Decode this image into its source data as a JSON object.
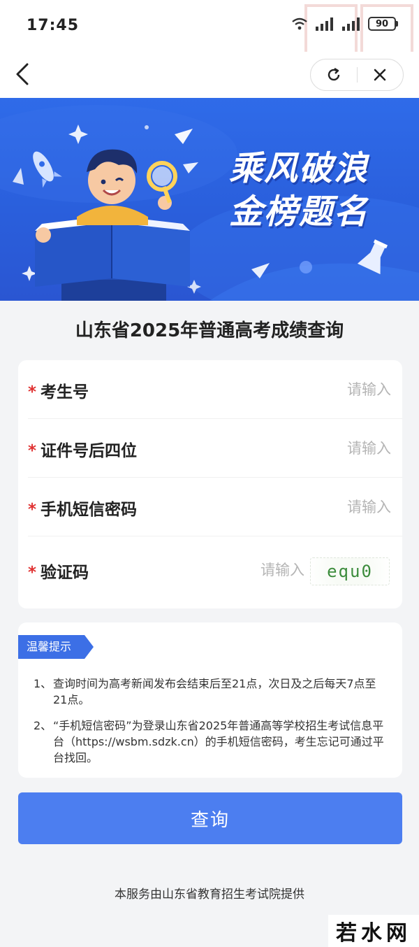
{
  "status_bar": {
    "time": "17:45",
    "battery": "90"
  },
  "nav": {
    "back_icon": "chevron-left-icon",
    "refresh_icon": "refresh-icon",
    "close_icon": "close-icon"
  },
  "banner": {
    "slogan_line1": "乘风破浪",
    "slogan_line2": "金榜题名"
  },
  "page_title": "山东省2025年普通高考成绩查询",
  "form": {
    "fields": [
      {
        "label": "考生号",
        "placeholder": "请输入"
      },
      {
        "label": "证件号后四位",
        "placeholder": "请输入"
      },
      {
        "label": "手机短信密码",
        "placeholder": "请输入"
      },
      {
        "label": "验证码",
        "placeholder": "请输入"
      }
    ],
    "required_mark": "*",
    "captcha_text": "equ0"
  },
  "tips": {
    "tag": "温馨提示",
    "items": [
      {
        "num": "1、",
        "text": "查询时间为高考新闻发布会结束后至21点，次日及之后每天7点至21点。"
      },
      {
        "num": "2、",
        "text": "“手机短信密码”为登录山东省2025年普通高等学校招生考试信息平台（https://wsbm.sdzk.cn）的手机短信密码，考生忘记可通过平台找回。"
      }
    ]
  },
  "submit_label": "查询",
  "footer": "本服务由山东省教育招生考试院提供",
  "site_mark": "若水网",
  "colors": {
    "primary": "#4c7ef0",
    "banner": "#2f6be9",
    "required": "#e03232",
    "page_bg": "#f3f4f6"
  }
}
